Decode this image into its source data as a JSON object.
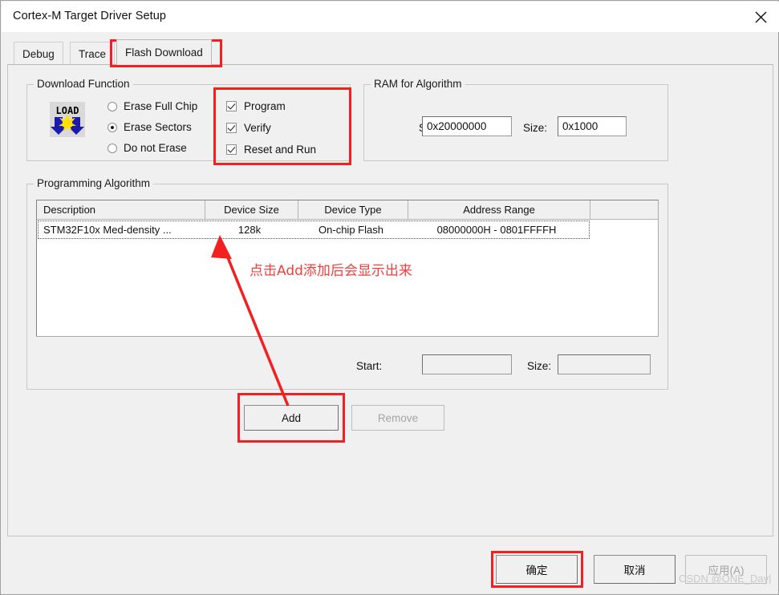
{
  "window": {
    "title": "Cortex-M Target Driver Setup",
    "close_icon": "close-icon"
  },
  "tabs": [
    {
      "label": "Debug",
      "selected": false
    },
    {
      "label": "Trace",
      "selected": false
    },
    {
      "label": "Flash Download",
      "selected": true
    }
  ],
  "download_function": {
    "legend": "Download Function",
    "icon": "load-icon",
    "radios": [
      {
        "label": "Erase Full Chip",
        "checked": false
      },
      {
        "label": "Erase Sectors",
        "checked": true
      },
      {
        "label": "Do not Erase",
        "checked": false
      }
    ],
    "checkboxes": [
      {
        "label": "Program",
        "checked": true
      },
      {
        "label": "Verify",
        "checked": true
      },
      {
        "label": "Reset and Run",
        "checked": true
      }
    ]
  },
  "ram_for_algorithm": {
    "legend": "RAM for Algorithm",
    "start_label": "Start:",
    "start_value": "0x20000000",
    "size_label": "Size:",
    "size_value": "0x1000"
  },
  "programming_algorithm": {
    "legend": "Programming Algorithm",
    "columns": [
      "Description",
      "Device Size",
      "Device Type",
      "Address Range",
      ""
    ],
    "rows": [
      {
        "description": "STM32F10x Med-density ...",
        "device_size": "128k",
        "device_type": "On-chip Flash",
        "address_range": "08000000H - 0801FFFFH",
        "extra": ""
      }
    ],
    "start_label": "Start:",
    "start_value": "",
    "size_label": "Size:",
    "size_value": "",
    "add_button": "Add",
    "remove_button": "Remove"
  },
  "dialog_buttons": {
    "ok": "确定",
    "cancel": "取消",
    "apply": "应用(A)"
  },
  "annotations": {
    "note_text": "点击Add添加后会显示出来",
    "highlight_color": "#f22020",
    "note_color": "#f53e3e"
  },
  "watermark": "CSDN @ONE_Day|"
}
